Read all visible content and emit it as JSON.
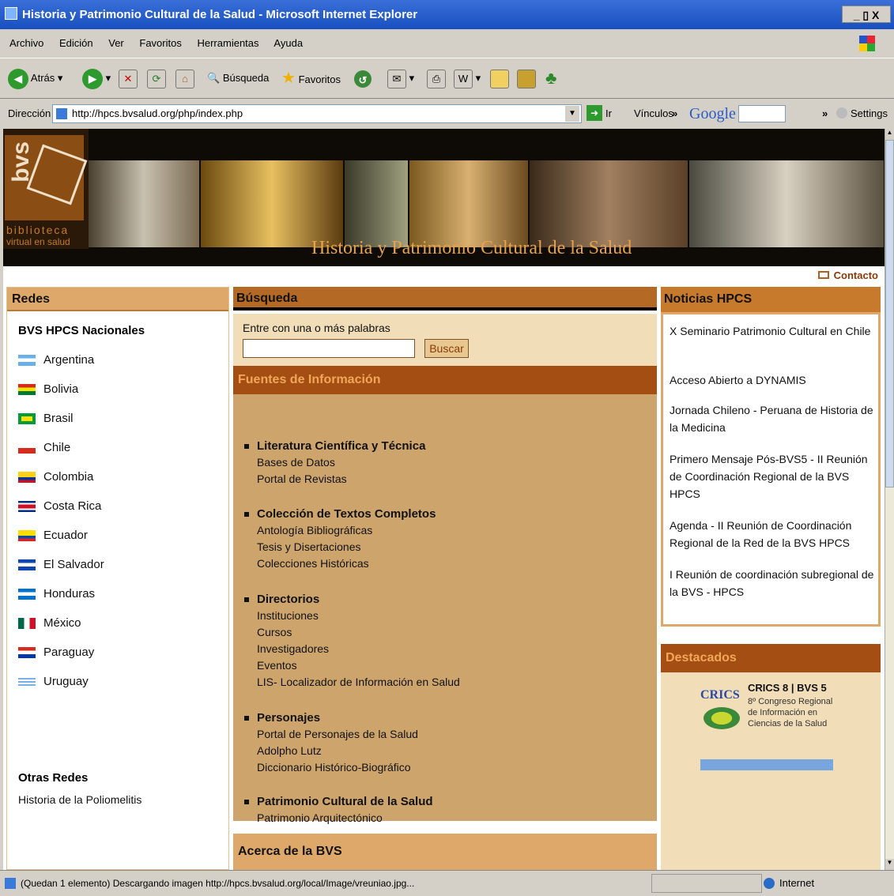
{
  "window": {
    "title": "Historia y Patrimonio Cultural de la Salud - Microsoft Internet Explorer",
    "controls": "_ ▯ X"
  },
  "menu": [
    "Archivo",
    "Edición",
    "Ver",
    "Favoritos",
    "Herramientas",
    "Ayuda"
  ],
  "toolbar": {
    "back": "Atrás",
    "search": "Búsqueda",
    "favorites": "Favoritos"
  },
  "address": {
    "label": "Dirección",
    "url": "http://hpcs.bvsalud.org/php/index.php",
    "go": "Ir",
    "links": "Vínculos",
    "google": "Google",
    "settings": "Settings"
  },
  "banner": {
    "logo_word": "bvs",
    "logo_sub1": "biblioteca",
    "logo_sub2": "virtual en salud",
    "title": "Historia y Patrimonio Cultural de la Salud"
  },
  "contact": "Contacto",
  "left": {
    "heading": "Redes",
    "subheading": "BVS HPCS Nacionales",
    "countries": [
      "Argentina",
      "Bolivia",
      "Brasil",
      "Chile",
      "Colombia",
      "Costa Rica",
      "Ecuador",
      "El Salvador",
      "Honduras",
      "México",
      "Paraguay",
      "Uruguay"
    ],
    "other_heading": "Otras Redes",
    "other_link": "Historia de la Poliomelitis"
  },
  "search": {
    "heading": "Búsqueda",
    "label": "Entre con una o más palabras",
    "value": "",
    "button": "Buscar"
  },
  "sources": {
    "heading": "Fuentes de Información",
    "sections": [
      {
        "title": "Literatura Científica y Técnica",
        "links": [
          "Bases de Datos",
          "Portal de Revistas"
        ]
      },
      {
        "title": "Colección de Textos Completos",
        "links": [
          "Antología Bibliográficas",
          "Tesis y Disertaciones",
          "Colecciones Históricas"
        ]
      },
      {
        "title": "Directorios",
        "links": [
          "Instituciones",
          "Cursos",
          "Investigadores",
          "Eventos",
          "LIS- Localizador de Información en Salud"
        ]
      },
      {
        "title": "Personajes",
        "links": [
          "Portal de Personajes de la Salud",
          "Adolpho Lutz",
          "Diccionario Histórico-Biográfico"
        ]
      },
      {
        "title": "Patrimonio Cultural de la Salud",
        "links": [
          "Patrimonio Arquitectónico"
        ]
      }
    ]
  },
  "about": {
    "heading": "Acerca de la BVS"
  },
  "news": {
    "heading": "Noticias HPCS",
    "items": [
      "X Seminario Patrimonio Cultural en Chile",
      "Acceso Abierto a DYNAMIS",
      "Jornada Chileno - Peruana de Historia de la Medicina",
      "Primero Mensaje Pós-BVS5 - II Reunión de Coordinación Regional de la BVS HPCS",
      "Agenda - II Reunión de Coordinación Regional de la Red de la BVS HPCS",
      "I Reunión de coordinación subregional de la BVS - HPCS"
    ]
  },
  "featured": {
    "heading": "Destacados",
    "logo_word": "CRICS",
    "title": "CRICS 8 | BVS 5",
    "subtitle": "8º Congreso Regional de Información en Ciencias de la Salud"
  },
  "status": {
    "text": "(Quedan 1 elemento) Descargando imagen http://hpcs.bvsalud.org/local/Image/vreuniao.jpg...",
    "zone": "Internet"
  },
  "icons": [
    "ie-icon",
    "back-icon",
    "forward-icon",
    "stop-icon",
    "refresh-icon",
    "home-icon",
    "search-icon",
    "favorites-star-icon",
    "history-icon",
    "mail-icon",
    "print-icon",
    "edit-icon",
    "messenger-icon",
    "page-icon",
    "go-arrow-icon",
    "envelope-icon",
    "globe-icon"
  ],
  "colors": {
    "accent": "#a44e14",
    "panel": "#dda86a",
    "light": "#f1ddb8",
    "body": "#cda56c"
  }
}
